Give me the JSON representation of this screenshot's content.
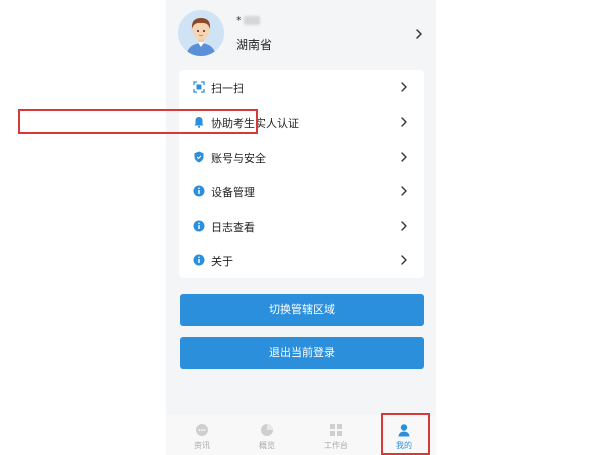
{
  "profile": {
    "username": "*",
    "province": "湖南省"
  },
  "menu": {
    "items": [
      {
        "label": "扫一扫",
        "icon": "scan-icon"
      },
      {
        "label": "协助考生实人认证",
        "icon": "bell-icon"
      },
      {
        "label": "账号与安全",
        "icon": "shield-icon"
      },
      {
        "label": "设备管理",
        "icon": "info-icon"
      },
      {
        "label": "日志查看",
        "icon": "info-icon"
      },
      {
        "label": "关于",
        "icon": "info-icon"
      }
    ]
  },
  "buttons": {
    "switch_region": "切换管辖区域",
    "logout": "退出当前登录"
  },
  "tabbar": {
    "tabs": [
      {
        "label": "资讯",
        "icon": "chat-icon"
      },
      {
        "label": "概览",
        "icon": "pie-chart-icon"
      },
      {
        "label": "工作台",
        "icon": "grid-icon"
      },
      {
        "label": "我的",
        "icon": "person-icon"
      }
    ]
  },
  "colors": {
    "accent": "#2c8fdc",
    "highlight": "#d6393a"
  }
}
